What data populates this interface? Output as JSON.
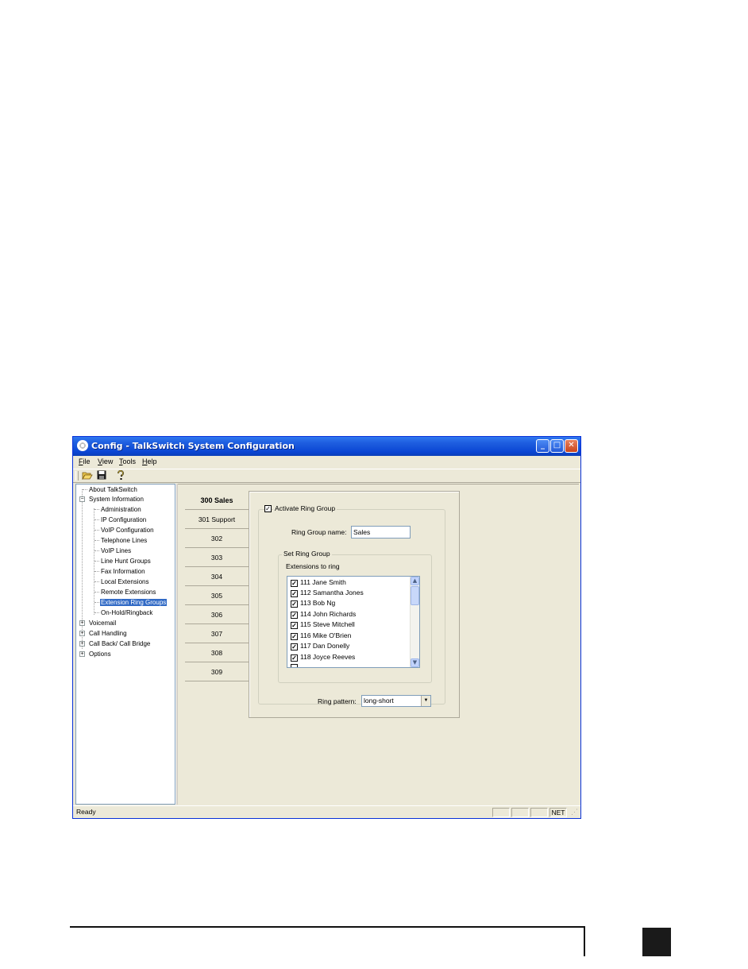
{
  "window": {
    "title": "Config - TalkSwitch System Configuration",
    "controls": {
      "minimize": "_",
      "maximize": "□",
      "close": "✕"
    }
  },
  "menu": [
    "File",
    "View",
    "Tools",
    "Help"
  ],
  "toolbar": {
    "icons": [
      "open-folder-icon",
      "save-icon",
      "help-icon"
    ]
  },
  "tree": {
    "about": "About TalkSwitch",
    "system_information": "System Information",
    "system_children": [
      "Administration",
      "IP Configuration",
      "VoIP Configuration",
      "Telephone Lines",
      "VoIP Lines",
      "Line Hunt Groups",
      "Fax Information",
      "Local Extensions",
      "Remote Extensions",
      "Extension Ring Groups",
      "On-Hold/Ringback"
    ],
    "selected": "Extension Ring Groups",
    "collapsed": [
      "Voicemail",
      "Call Handling",
      "Call Back/ Call Bridge",
      "Options"
    ]
  },
  "tabs": [
    "300 Sales",
    "301 Support",
    "302",
    "303",
    "304",
    "305",
    "306",
    "307",
    "308",
    "309"
  ],
  "active_tab": "300 Sales",
  "form": {
    "activate_label": "Activate Ring Group",
    "activate_checked": true,
    "ring_group_name_label": "Ring Group name:",
    "ring_group_name_value": "Sales",
    "set_ring_group_label": "Set Ring Group",
    "extensions_label": "Extensions to ring",
    "extensions": [
      "111 Jane Smith",
      "112 Samantha Jones",
      "113 Bob Ng",
      "114 John Richards",
      "115 Steve Mitchell",
      "116 Mike O'Brien",
      "117 Dan Donelly",
      "118 Joyce Reeves"
    ],
    "ring_pattern_label": "Ring pattern:",
    "ring_pattern_value": "long-short"
  },
  "status": {
    "text": "Ready",
    "net": "NET"
  }
}
